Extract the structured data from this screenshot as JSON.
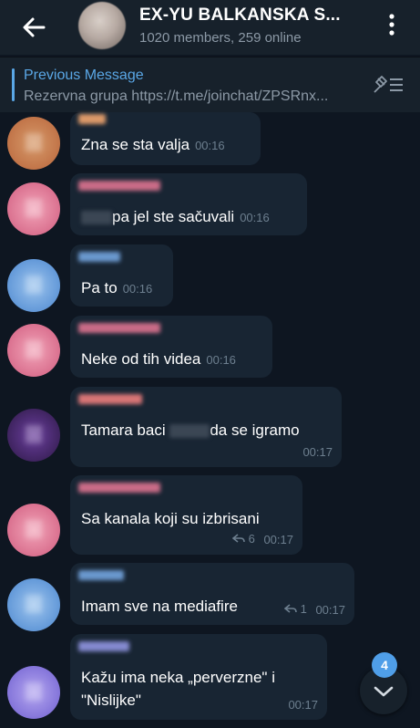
{
  "header": {
    "title": "EX-YU BALKANSKA S...",
    "subtitle": "1020 members, 259 online",
    "icons": {
      "back": "arrow-left-icon",
      "menu": "more-vertical-icon"
    }
  },
  "pinned": {
    "title": "Previous Message",
    "text": "Rezervna grupa https://t.me/joinchat/ZPSRnx...",
    "icon": "unpin-list-icon"
  },
  "messages": [
    {
      "text": "Zna se sta valja",
      "time": "00:16"
    },
    {
      "text_after_redaction": "pa jel ste sačuvali",
      "time": "00:16"
    },
    {
      "text": "Pa to",
      "time": "00:16"
    },
    {
      "text": "Neke od tih videa",
      "time": "00:16"
    },
    {
      "text_before": "Tamara baci",
      "text_after": "da se igramo",
      "time": "00:17"
    },
    {
      "text": "Sa kanala koji su izbrisani",
      "replies": "6",
      "time": "00:17"
    },
    {
      "text": "Imam sve na mediafire",
      "replies": "1",
      "time": "00:17"
    },
    {
      "line1": "Kažu ima neka „perverzne\" i",
      "line2": "\"Nislijke\"",
      "time": "00:17"
    }
  ],
  "scroll_down": {
    "unread_count": "4",
    "icon": "chevron-down-icon"
  },
  "colors": {
    "background": "#0e1621",
    "bar": "#17212b",
    "bubble": "#182533",
    "accent": "#5aa7e6",
    "badge": "#4f9ee8",
    "muted": "#6d7f8f"
  }
}
